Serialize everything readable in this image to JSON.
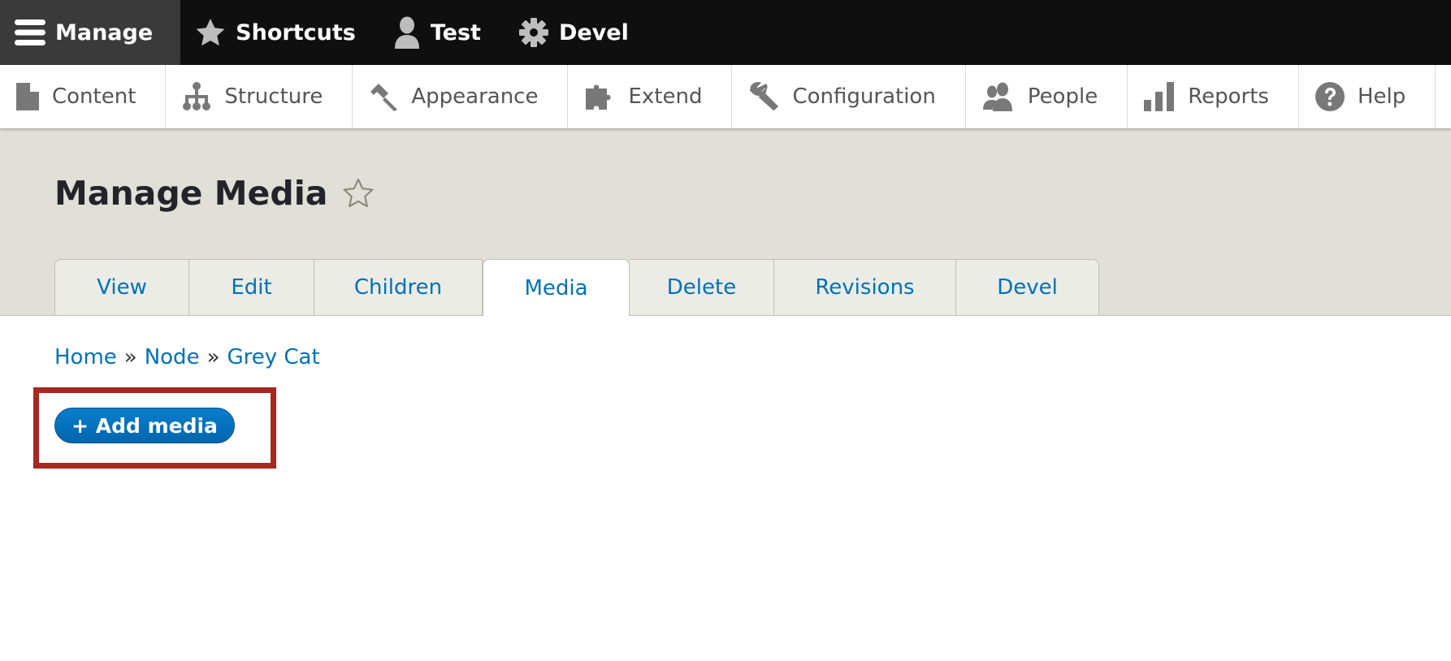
{
  "toolbar": {
    "items": [
      {
        "label": "Manage",
        "icon": "menu-icon",
        "active": true
      },
      {
        "label": "Shortcuts",
        "icon": "star-icon"
      },
      {
        "label": "Test",
        "icon": "user-icon"
      },
      {
        "label": "Devel",
        "icon": "gear-icon"
      }
    ]
  },
  "tray": {
    "items": [
      {
        "label": "Content",
        "icon": "document-icon"
      },
      {
        "label": "Structure",
        "icon": "sitemap-icon"
      },
      {
        "label": "Appearance",
        "icon": "paintbrush-icon"
      },
      {
        "label": "Extend",
        "icon": "puzzle-icon"
      },
      {
        "label": "Configuration",
        "icon": "wrench-icon"
      },
      {
        "label": "People",
        "icon": "people-icon"
      },
      {
        "label": "Reports",
        "icon": "bar-chart-icon"
      },
      {
        "label": "Help",
        "icon": "help-icon"
      }
    ]
  },
  "header": {
    "title": "Manage Media",
    "shortcut_icon": "star-outline-icon"
  },
  "tabs": [
    {
      "label": "View"
    },
    {
      "label": "Edit"
    },
    {
      "label": "Children"
    },
    {
      "label": "Media",
      "active": true
    },
    {
      "label": "Delete"
    },
    {
      "label": "Revisions"
    },
    {
      "label": "Devel"
    }
  ],
  "breadcrumb": {
    "items": [
      "Home",
      "Node",
      "Grey Cat"
    ],
    "separator": "»"
  },
  "actions": {
    "add_media_label": "+ Add media"
  },
  "colors": {
    "toolbar_bg": "#0f0f0f",
    "header_bg": "#e0e0d8",
    "link": "#0071b8",
    "primary_button": "#0074bd",
    "highlight_border": "#a8271f"
  }
}
